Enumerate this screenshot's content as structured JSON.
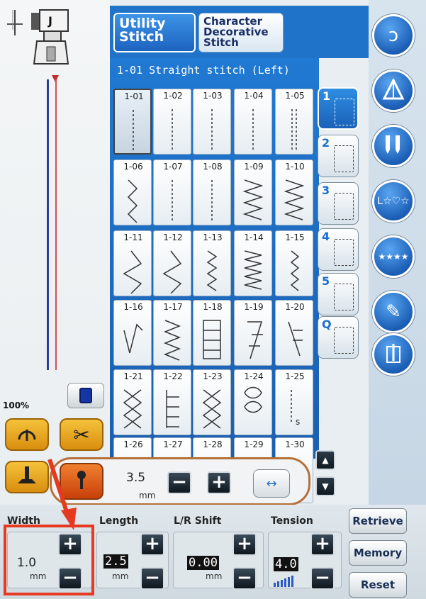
{
  "tabs": {
    "utility": "Utility\nStitch",
    "utility_l1": "Utility",
    "utility_l2": "Stitch",
    "character_l1": "Character",
    "character_l2": "Decorative",
    "character_l3": "Stitch",
    "pattern_icon": "stitch-pattern-icon"
  },
  "presser_foot": {
    "label": "J"
  },
  "selected_stitch": "1-01 Straight stitch (Left)",
  "stitches": [
    "1-01",
    "1-02",
    "1-03",
    "1-04",
    "1-05",
    "1-06",
    "1-07",
    "1-08",
    "1-09",
    "1-10",
    "1-11",
    "1-12",
    "1-13",
    "1-14",
    "1-15",
    "1-16",
    "1-17",
    "1-18",
    "1-19",
    "1-20",
    "1-21",
    "1-22",
    "1-23",
    "1-24",
    "1-25",
    "1-26",
    "1-27",
    "1-28",
    "1-29",
    "1-30"
  ],
  "stitch_1_25_label": "s",
  "categories": [
    {
      "num": "1"
    },
    {
      "num": "2"
    },
    {
      "num": "3"
    },
    {
      "num": "4"
    },
    {
      "num": "5"
    },
    {
      "num": "Q"
    }
  ],
  "zoom": "100%",
  "pivot": {
    "value": "3.5",
    "unit": "mm"
  },
  "width": {
    "label": "Width",
    "value": "1.0",
    "unit": "mm"
  },
  "length": {
    "label": "Length",
    "value": "2.5",
    "unit": "mm"
  },
  "lr_shift": {
    "label": "L/R Shift",
    "value": "0.00",
    "unit": "mm"
  },
  "tension": {
    "label": "Tension",
    "value": "4.0"
  },
  "buttons": {
    "retrieve": "Retrieve",
    "memory": "Memory",
    "reset": "Reset",
    "plus": "+",
    "minus": "−"
  },
  "colors": {
    "accent": "#1f73c9",
    "orange": "#e69a1c",
    "highlight": "#e53a20"
  }
}
